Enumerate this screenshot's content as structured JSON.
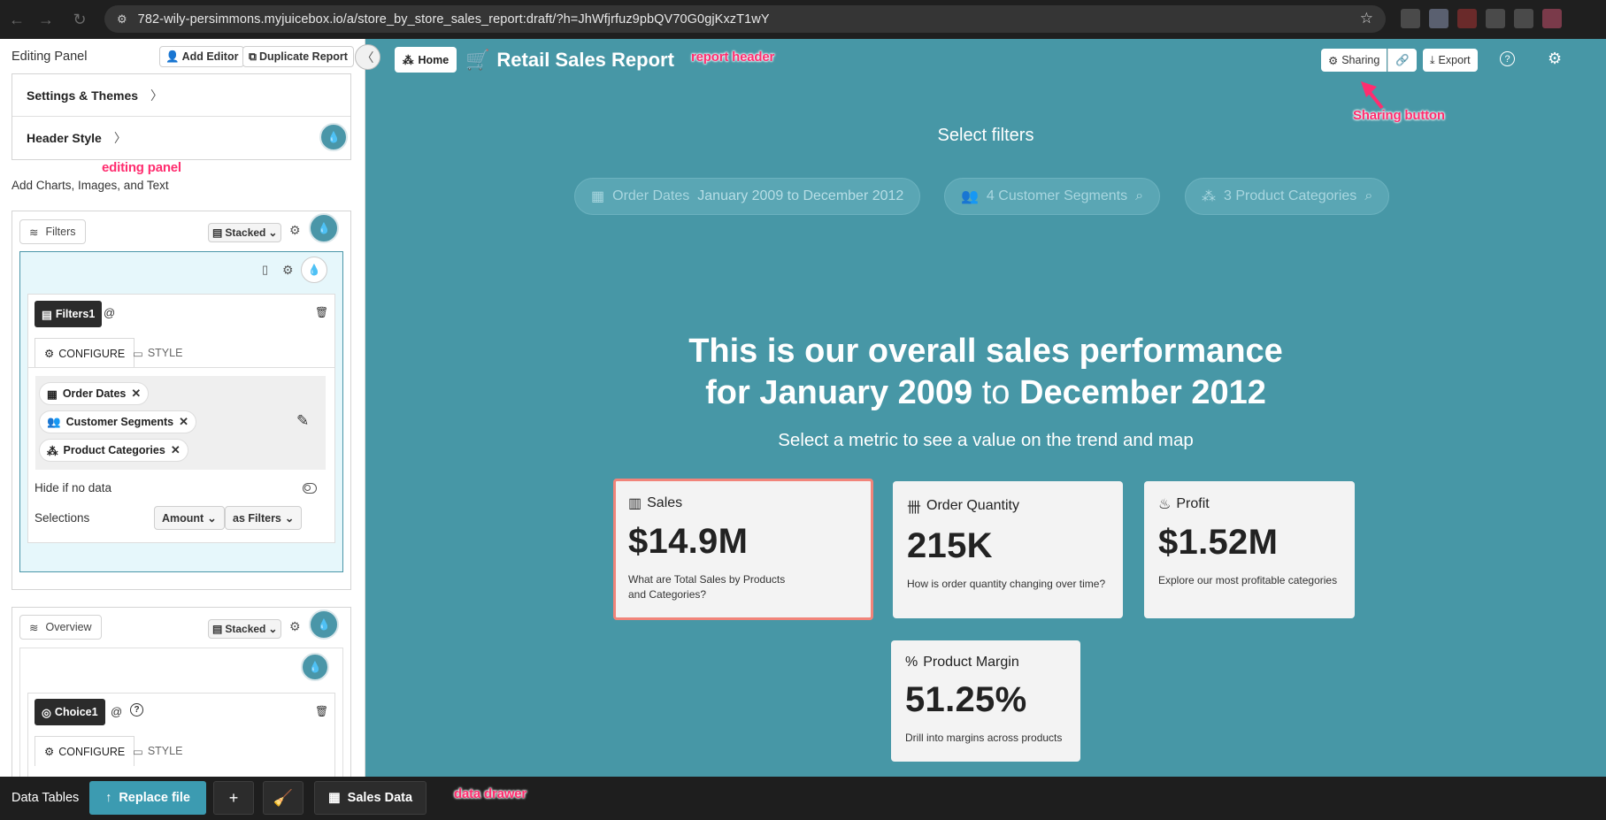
{
  "browser": {
    "url": "782-wily-persimmons.myjuicebox.io/a/store_by_store_sales_report:draft/?h=JhWfjrfuz9pbQV70G0gjKxzT1wY"
  },
  "editing_panel": {
    "title": "Editing Panel",
    "add_editor": "Add Editor",
    "duplicate_report": "Duplicate Report",
    "settings_themes": "Settings & Themes",
    "header_style": "Header Style",
    "add_label": "Add Charts, Images, and Text",
    "filters_section": {
      "name": "Filters",
      "layout": "Stacked",
      "chip": "Filters1",
      "tab_configure": "CONFIGURE",
      "tab_style": "STYLE",
      "filters": [
        "Order Dates",
        "Customer Segments",
        "Product Categories"
      ],
      "hide_label": "Hide if no data",
      "selections_label": "Selections",
      "amount_select": "Amount",
      "as_select": "as Filters"
    },
    "overview_section": {
      "name": "Overview",
      "layout": "Stacked",
      "chip": "Choice1",
      "tab_configure": "CONFIGURE",
      "tab_style": "STYLE"
    }
  },
  "annotations": {
    "report_header": "report header",
    "sharing_button": "Sharing button",
    "editing_panel": "editing panel",
    "data_drawer": "data drawer"
  },
  "report": {
    "home": "Home",
    "title": "Retail Sales Report",
    "sharing": "Sharing",
    "export": "Export",
    "select_filters": "Select filters",
    "filter_pills": {
      "dates_label": "Order Dates",
      "dates_value": "January 2009 to December 2012",
      "segments": "4 Customer Segments",
      "categories": "3 Product Categories"
    },
    "headline": {
      "line1": "This is our overall sales performance",
      "for": "for January 2009",
      "to": "to",
      "end": "December 2012"
    },
    "subheadline": "Select a metric to see a value on the trend and map",
    "kpis": [
      {
        "title": "Sales",
        "value": "$14.9M",
        "desc": "What are Total Sales by Products and Categories?"
      },
      {
        "title": "Order Quantity",
        "value": "215K",
        "desc": "How is order quantity changing over time?"
      },
      {
        "title": "Profit",
        "value": "$1.52M",
        "desc": "Explore our most profitable categories"
      },
      {
        "title": "Product Margin",
        "value": "51.25%",
        "desc": "Drill into margins across products"
      }
    ]
  },
  "data_drawer": {
    "label": "Data Tables",
    "replace_file": "Replace file",
    "table": "Sales Data"
  },
  "colors": {
    "report_bg": "#4797a6",
    "accent": "#3c9bb1",
    "selected_border": "#f1847a",
    "annotation": "#ff2d6f"
  }
}
